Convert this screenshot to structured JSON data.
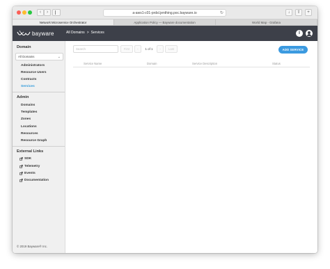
{
  "browser": {
    "url": "a-aws1-c01-prdsl.jenthing.poc.bayware.io",
    "tabs": [
      {
        "label": "Network Microservice Orchestrator",
        "active": true
      },
      {
        "label": "Application Policy — Bayware documentation",
        "active": false
      },
      {
        "label": "World Map - Grafana",
        "active": false
      }
    ]
  },
  "header": {
    "logo_text": "bayware",
    "breadcrumb": {
      "root": "All Domains",
      "separator": ">",
      "current": "Services"
    },
    "info_label": "i"
  },
  "sidebar": {
    "domain_heading": "Domain",
    "domain_select": {
      "value": "All Domains",
      "caret": "⌄"
    },
    "domain_items": [
      {
        "label": "Administrators",
        "active": false
      },
      {
        "label": "Resource Users",
        "active": false
      },
      {
        "label": "Contracts",
        "active": false
      },
      {
        "label": "Services",
        "active": true
      }
    ],
    "admin_heading": "Admin",
    "admin_items": [
      {
        "label": "Domains"
      },
      {
        "label": "Templates"
      },
      {
        "label": "Zones"
      },
      {
        "label": "Locations"
      },
      {
        "label": "Resources"
      },
      {
        "label": "Resource Graph"
      }
    ],
    "external_heading": "External Links",
    "external_items": [
      {
        "label": "SDK"
      },
      {
        "label": "Telemetry"
      },
      {
        "label": "Events"
      },
      {
        "label": "Documentation"
      }
    ],
    "footer": "© 2019 Bayware® Inc."
  },
  "main": {
    "search_placeholder": "Search",
    "pagination": {
      "first": "First",
      "prev": "‹",
      "status": "1 of 1",
      "next": "›",
      "last": "Last"
    },
    "add_button": "ADD SERVICE",
    "columns": [
      "Service Name",
      "Domain",
      "Service Description",
      "Status"
    ]
  },
  "colors": {
    "header_bg": "#3d4049",
    "accent": "#3b9ae0",
    "active_link": "#2f9adb",
    "sidebar_bg": "#f0f0f0"
  }
}
